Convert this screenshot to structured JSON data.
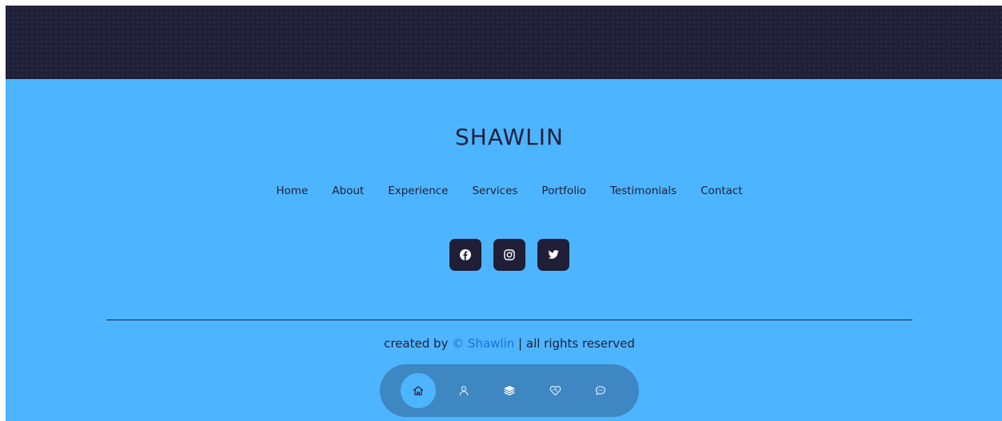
{
  "footer": {
    "logo": "SHAWLIN",
    "nav": [
      {
        "label": "Home"
      },
      {
        "label": "About"
      },
      {
        "label": "Experience"
      },
      {
        "label": "Services"
      },
      {
        "label": "Portfolio"
      },
      {
        "label": "Testimonials"
      },
      {
        "label": "Contact"
      }
    ],
    "socials": [
      "facebook-icon",
      "instagram-icon",
      "twitter-icon"
    ],
    "copyright": {
      "prefix": "created by ",
      "brand": "© Shawlin",
      "suffix": " | all rights reserved"
    }
  },
  "floating_nav": {
    "items": [
      "home-icon",
      "user-icon",
      "layers-icon",
      "heart-handshake-icon",
      "chat-icon"
    ],
    "active": "home-icon"
  },
  "colors": {
    "background_dark": "#1f1f38",
    "primary": "#4db5ff",
    "brand_link": "#1f6fd8"
  }
}
